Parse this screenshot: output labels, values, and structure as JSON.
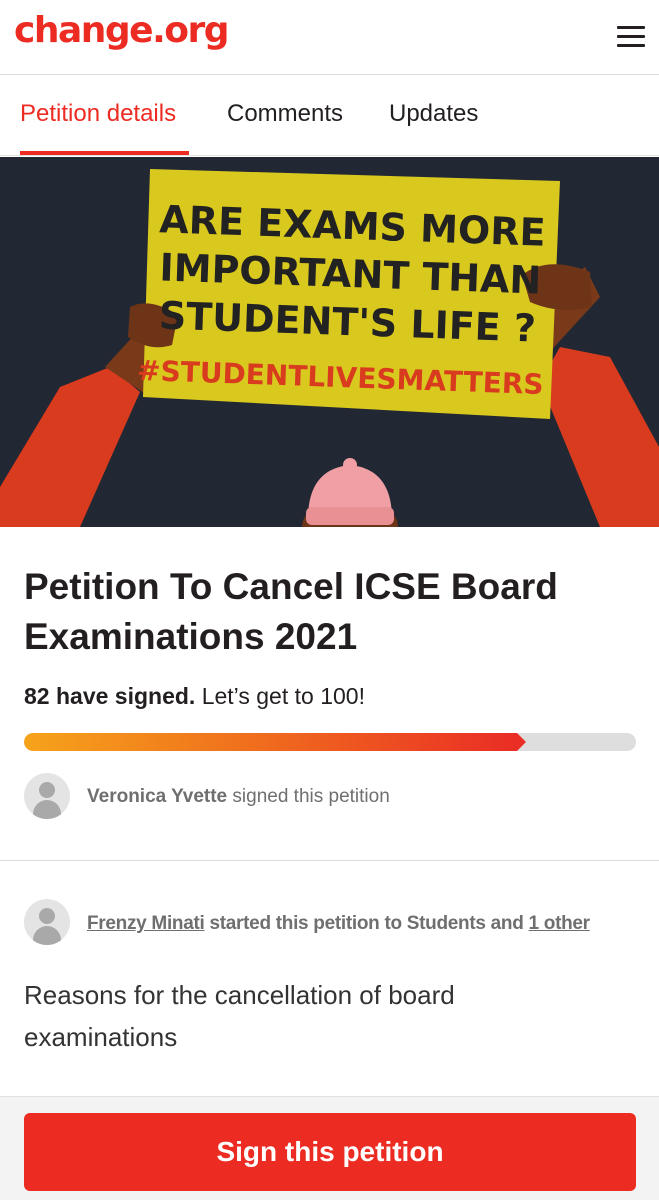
{
  "header": {
    "logo": "change.org",
    "menu_icon": "hamburger-menu-icon"
  },
  "tabs": [
    {
      "label": "Petition details",
      "active": true
    },
    {
      "label": "Comments",
      "active": false
    },
    {
      "label": "Updates",
      "active": false
    }
  ],
  "hero": {
    "sign_line1": "ARE EXAMS MORE",
    "sign_line2": "IMPORTANT THAN",
    "sign_line3": "STUDENT'S LIFE ?",
    "hashtag": "#STUDENTLIVESMATTERS"
  },
  "petition": {
    "title": "Petition To Cancel ICSE Board Examinations 2021",
    "signed_count": "82 have signed.",
    "goal_text": "Let’s get to 100!",
    "progress_fraction": 0.82
  },
  "recent_signer": {
    "name": "Veronica Yvette",
    "action": "signed this petition"
  },
  "starter": {
    "name": "Frenzy Minati",
    "middle": "started this petition to Students and",
    "other": "1 other"
  },
  "description": "Reasons for the cancellation of board examinations",
  "cta": {
    "label": "Sign this petition"
  },
  "colors": {
    "brand_red": "#ec2c22",
    "progress_start": "#f6a31b",
    "hero_bg": "#222833",
    "sign_yellow": "#d9c81e"
  }
}
